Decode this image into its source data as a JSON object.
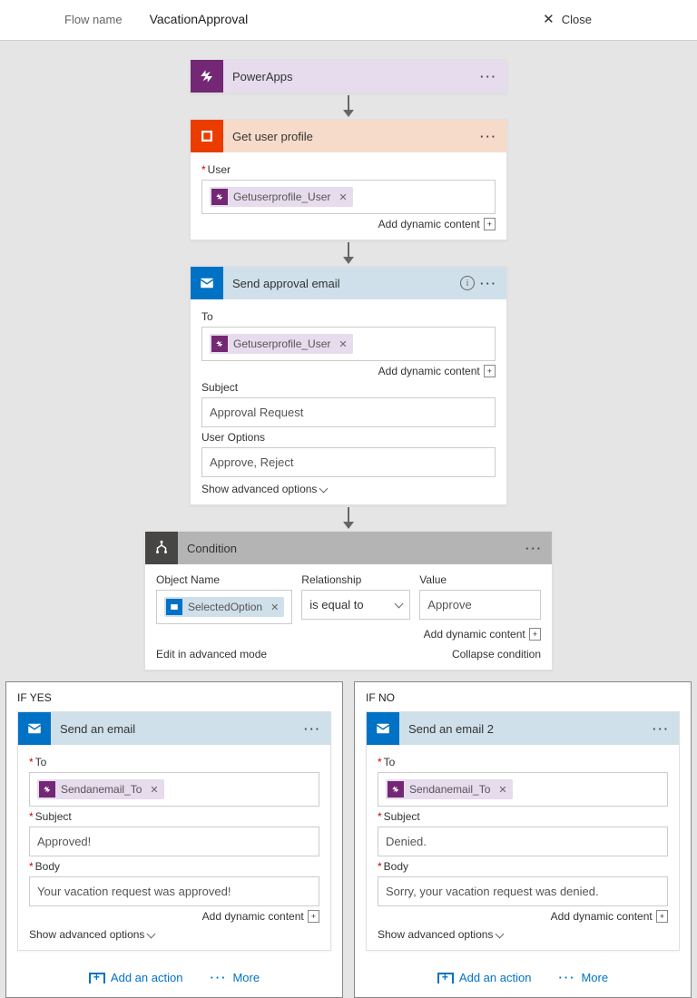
{
  "header": {
    "name_label": "Flow name",
    "name": "VacationApproval",
    "close": "Close"
  },
  "dyn_link": "Add dynamic content",
  "adv": "Show advanced options",
  "steps": {
    "trigger": {
      "title": "PowerApps"
    },
    "profile": {
      "title": "Get user profile",
      "user_label": "User",
      "user_tag": "Getuserprofile_User"
    },
    "approval": {
      "title": "Send approval email",
      "to_label": "To",
      "to_tag": "Getuserprofile_User",
      "subject_label": "Subject",
      "subject": "Approval Request",
      "options_label": "User Options",
      "options": "Approve, Reject"
    },
    "condition": {
      "title": "Condition",
      "obj_label": "Object Name",
      "obj_tag": "SelectedOption",
      "rel_label": "Relationship",
      "rel": "is equal to",
      "val_label": "Value",
      "val": "Approve",
      "edit_adv": "Edit in advanced mode",
      "collapse": "Collapse condition"
    }
  },
  "branches": {
    "yes": {
      "title": "IF YES",
      "card_title": "Send an email",
      "to_label": "To",
      "to_tag": "Sendanemail_To",
      "subject_label": "Subject",
      "subject": "Approved!",
      "body_label": "Body",
      "body": "Your vacation request was approved!"
    },
    "no": {
      "title": "IF NO",
      "card_title": "Send an email 2",
      "to_label": "To",
      "to_tag": "Sendanemail_To",
      "subject_label": "Subject",
      "subject": "Denied.",
      "body_label": "Body",
      "body": "Sorry, your vacation request was denied."
    },
    "add_action": "Add an action",
    "more": "More"
  }
}
